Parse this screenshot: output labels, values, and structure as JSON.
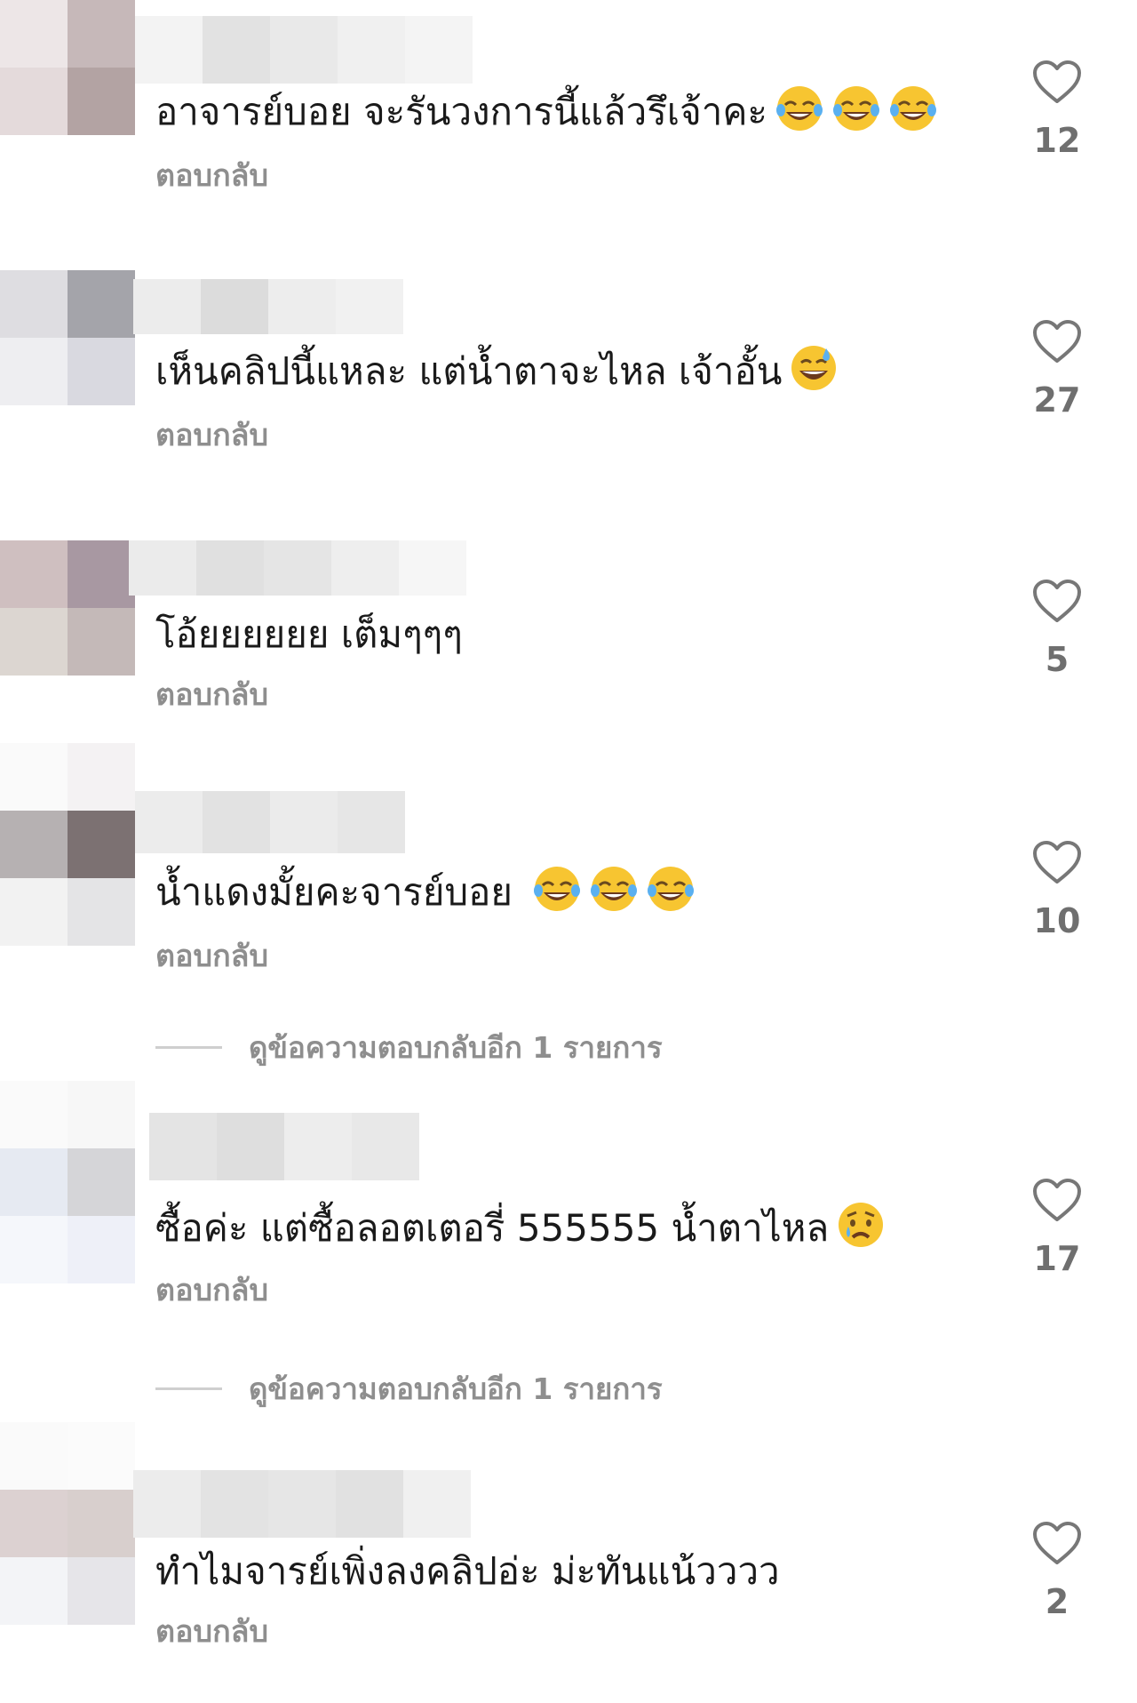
{
  "reply_label": "ตอบกลับ",
  "comments": [
    {
      "text": "อาจารย์บอย จะรันวงการนี้แล้วรึเจ้าคะ",
      "emoji": [
        "face-with-tears-of-joy",
        "face-with-tears-of-joy",
        "face-with-tears-of-joy"
      ],
      "likes": "12"
    },
    {
      "text": "เห็นคลิปนี้แหละ แต่น้ำตาจะไหล เจ้าอั้น",
      "emoji": [
        "grinning-face-with-sweat"
      ],
      "likes": "27"
    },
    {
      "text": "โอ้ยยยยยย เต็มๆๆๆ",
      "emoji": [],
      "likes": "5"
    },
    {
      "text": "น้ำแดงมั้ยคะจารย์บอย",
      "emoji": [
        "face-with-tears-of-joy",
        "face-with-tears-of-joy",
        "face-with-tears-of-joy"
      ],
      "likes": "10",
      "view_replies": "ดูข้อความตอบกลับอีก 1 รายการ"
    },
    {
      "text": "ซื้อค่ะ แต่ซื้อลอตเตอรี่ 555555 น้ำตาไหล",
      "emoji": [
        "crying-face"
      ],
      "likes": "17",
      "view_replies": "ดูข้อความตอบกลับอีก 1 รายการ"
    },
    {
      "text": "ทำไมจารย์เพิ่งลงคลิปอ่ะ ม่ะทันแน้วววว",
      "emoji": [],
      "likes": "2"
    }
  ],
  "icons": {
    "like": "heart-outline-icon"
  },
  "colors": {
    "text": "#1a1a1a",
    "secondary": "#8e8e8e",
    "heart": "#777777"
  }
}
